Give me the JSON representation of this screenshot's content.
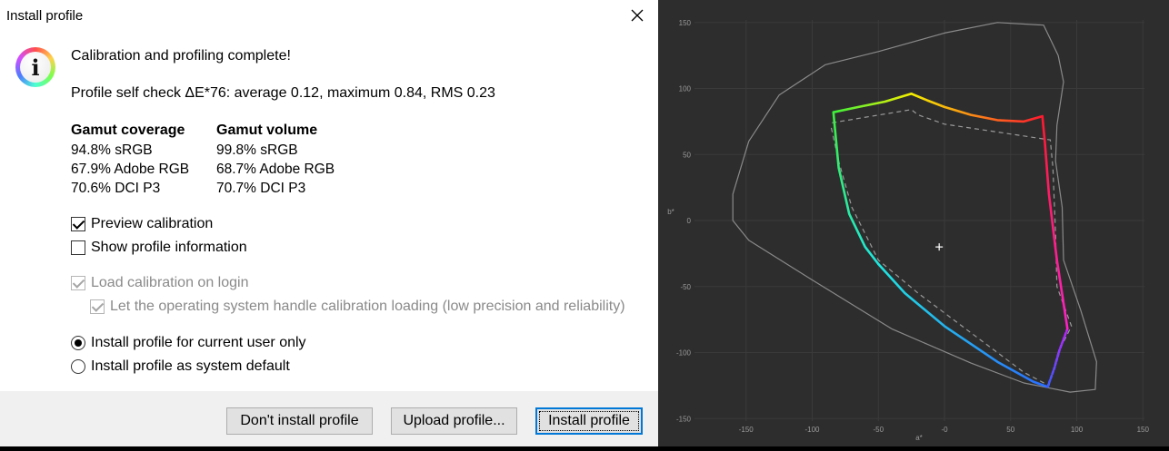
{
  "window": {
    "title": "Install profile"
  },
  "message": {
    "heading": "Calibration and profiling complete!",
    "self_check": "Profile self check ΔE*76: average 0.12, maximum 0.84, RMS 0.23"
  },
  "gamut": {
    "coverage_title": "Gamut coverage",
    "coverage": [
      "94.8% sRGB",
      "67.9% Adobe RGB",
      "70.6% DCI P3"
    ],
    "volume_title": "Gamut volume",
    "volume": [
      "99.8% sRGB",
      "68.7% Adobe RGB",
      "70.7% DCI P3"
    ]
  },
  "options": {
    "preview_calibration": {
      "label": "Preview calibration",
      "checked": true
    },
    "show_profile_info": {
      "label": "Show profile information",
      "checked": false
    },
    "load_calibration": {
      "label": "Load calibration on login",
      "checked": true,
      "enabled": false
    },
    "os_handle": {
      "label": "Let the operating system handle calibration loading (low precision and reliability)",
      "checked": true,
      "enabled": false
    },
    "install_user": {
      "label": "Install profile for current user only",
      "selected": true
    },
    "install_system": {
      "label": "Install profile as system default",
      "selected": false
    }
  },
  "buttons": {
    "dont_install": "Don't install profile",
    "upload": "Upload profile...",
    "install": "Install profile"
  },
  "chart_data": {
    "type": "line",
    "x_ticks": [
      "-150",
      "-100",
      "-50",
      "-0",
      "50",
      "100",
      "150"
    ],
    "y_ticks": [
      "150",
      "100",
      "50",
      "0",
      "-50",
      "-100",
      "-150"
    ],
    "xlabel": "a*",
    "ylabel": "b*",
    "xlim": [
      -170,
      170
    ],
    "ylim": [
      -150,
      150
    ],
    "grid": true,
    "colors": {
      "background": "#2d2d2d",
      "grid": "#3a3a3a",
      "outline": "#8a8a8a",
      "reference": "#9a9a9a"
    },
    "series": [
      {
        "role": "visible-locus-outline",
        "points": [
          [
            -160,
            20
          ],
          [
            -148,
            60
          ],
          [
            -125,
            95
          ],
          [
            -90,
            118
          ],
          [
            -50,
            128
          ],
          [
            0,
            142
          ],
          [
            40,
            150
          ],
          [
            75,
            148
          ],
          [
            86,
            125
          ],
          [
            90,
            105
          ],
          [
            85,
            72
          ],
          [
            84,
            45
          ],
          [
            89,
            10
          ],
          [
            90,
            -30
          ],
          [
            103,
            -68
          ],
          [
            115,
            -107
          ],
          [
            114,
            -128
          ],
          [
            95,
            -130
          ],
          [
            60,
            -123
          ],
          [
            20,
            -108
          ],
          [
            -40,
            -82
          ],
          [
            -100,
            -45
          ],
          [
            -148,
            -15
          ],
          [
            -160,
            0
          ],
          [
            -160,
            20
          ]
        ]
      },
      {
        "role": "reference-gamut-dashed",
        "points": [
          [
            -85,
            74
          ],
          [
            -25,
            84
          ],
          [
            -20,
            80
          ],
          [
            0,
            73
          ],
          [
            80,
            61
          ],
          [
            82,
            40
          ],
          [
            84,
            -10
          ],
          [
            85,
            -50
          ],
          [
            96,
            -80
          ],
          [
            86,
            -100
          ],
          [
            79,
            -125
          ],
          [
            60,
            -115
          ],
          [
            20,
            -85
          ],
          [
            -20,
            -55
          ],
          [
            -50,
            -30
          ],
          [
            -70,
            10
          ],
          [
            -80,
            45
          ],
          [
            -86,
            72
          ]
        ]
      },
      {
        "role": "profile-gamut",
        "segments": [
          {
            "from": "red",
            "to": "yellow",
            "points": [
              [
                74,
                79
              ],
              [
                60,
                75
              ],
              [
                40,
                76
              ],
              [
                20,
                80
              ],
              [
                0,
                86
              ],
              [
                -13,
                91
              ],
              [
                -25,
                96
              ]
            ]
          },
          {
            "from": "yellow",
            "to": "green",
            "points": [
              [
                -25,
                96
              ],
              [
                -45,
                90
              ],
              [
                -65,
                86
              ],
              [
                -84,
                82
              ]
            ]
          },
          {
            "from": "green",
            "to": "cyan",
            "points": [
              [
                -84,
                82
              ],
              [
                -80,
                40
              ],
              [
                -72,
                5
              ],
              [
                -60,
                -20
              ],
              [
                -50,
                -33
              ]
            ]
          },
          {
            "from": "cyan",
            "to": "blue",
            "points": [
              [
                -50,
                -33
              ],
              [
                -30,
                -55
              ],
              [
                0,
                -80
              ],
              [
                40,
                -107
              ],
              [
                67,
                -122
              ],
              [
                78,
                -126
              ]
            ]
          },
          {
            "from": "blue",
            "to": "magenta",
            "points": [
              [
                78,
                -126
              ],
              [
                83,
                -112
              ],
              [
                87,
                -98
              ],
              [
                93,
                -82
              ]
            ]
          },
          {
            "from": "magenta",
            "to": "red",
            "points": [
              [
                93,
                -82
              ],
              [
                85,
                -30
              ],
              [
                79,
                20
              ],
              [
                76,
                58
              ],
              [
                74,
                79
              ]
            ]
          }
        ]
      }
    ],
    "white_point": [
      -4,
      -20
    ]
  }
}
